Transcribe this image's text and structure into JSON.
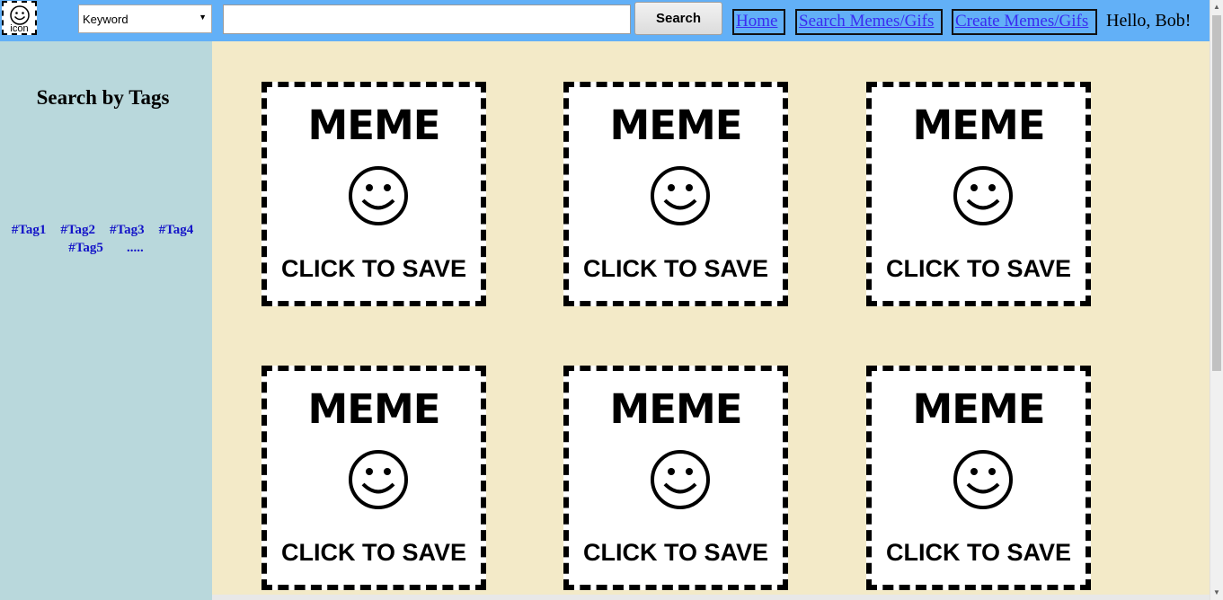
{
  "header": {
    "logo_text": "icon",
    "search_type": {
      "selected": "Keyword"
    },
    "search_input": {
      "value": "",
      "placeholder": ""
    },
    "search_button": "Search",
    "nav": [
      {
        "label": "Home "
      },
      {
        "label": "Search Memes/Gifs"
      },
      {
        "label": "Create Memes/Gifs"
      }
    ],
    "greeting": "Hello, Bob!"
  },
  "sidebar": {
    "title": "Search by Tags",
    "tags": [
      "#Tag1",
      "#Tag2",
      "#Tag3",
      "#Tag4",
      "#Tag5",
      "....."
    ]
  },
  "cards": [
    {
      "title": "MEME",
      "cta": "CLICK TO SAVE",
      "icon": "smiley-icon"
    },
    {
      "title": "MEME",
      "cta": "CLICK TO SAVE",
      "icon": "smiley-icon"
    },
    {
      "title": "MEME",
      "cta": "CLICK TO SAVE",
      "icon": "smiley-icon"
    },
    {
      "title": "MEME",
      "cta": "CLICK TO SAVE",
      "icon": "smiley-icon"
    },
    {
      "title": "MEME",
      "cta": "CLICK TO SAVE",
      "icon": "smiley-icon"
    },
    {
      "title": "MEME",
      "cta": "CLICK TO SAVE",
      "icon": "smiley-icon"
    }
  ],
  "colors": {
    "topbar": "#62b0f7",
    "sidebar": "#b9d8dc",
    "content": "#f3eac8",
    "tag_link": "#1414c8",
    "nav_link": "#3a2cf0"
  }
}
